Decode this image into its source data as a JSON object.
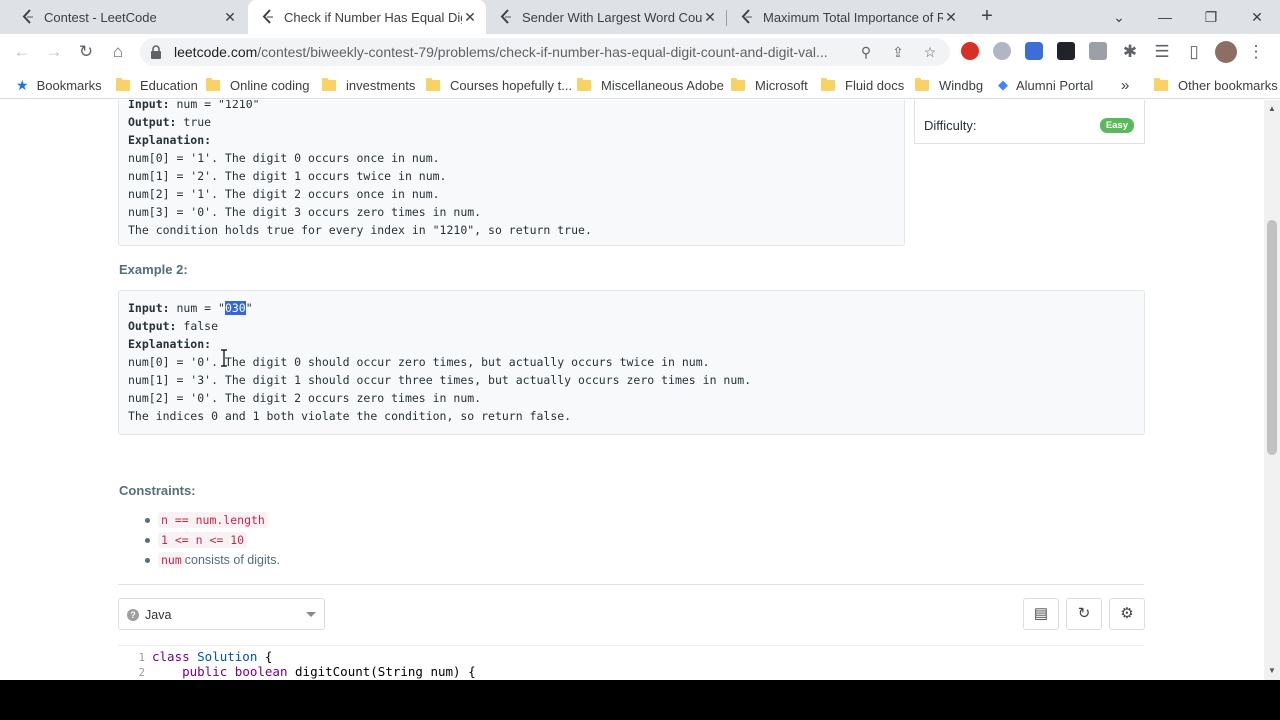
{
  "tabs": [
    {
      "title": "Contest - LeetCode",
      "active": false
    },
    {
      "title": "Check if Number Has Equal Digit",
      "active": true
    },
    {
      "title": "Sender With Largest Word Count",
      "active": false
    },
    {
      "title": "Maximum Total Importance of Ro",
      "active": false
    }
  ],
  "toolbar": {
    "url_host": "leetcode.com",
    "url_path": "/contest/biweekly-contest-79/problems/check-if-number-has-equal-digit-count-and-digit-val..."
  },
  "bookmarks": {
    "items": [
      "Bookmarks",
      "Education",
      "Online coding",
      "investments",
      "Courses hopefully t...",
      "Miscellaneous Adobe",
      "Microsoft",
      "Fluid docs",
      "Windbg",
      "Alumni Portal"
    ],
    "overflow": "»",
    "other": "Other bookmarks"
  },
  "example1": {
    "lines": [
      {
        "label": "Input:",
        "text": " num = \"1210\""
      },
      {
        "label": "Output:",
        "text": " true"
      },
      {
        "label": "Explanation:",
        "text": ""
      },
      {
        "label": "",
        "text": "num[0] = '1'. The digit 0 occurs once in num."
      },
      {
        "label": "",
        "text": "num[1] = '2'. The digit 1 occurs twice in num."
      },
      {
        "label": "",
        "text": "num[2] = '1'. The digit 2 occurs once in num."
      },
      {
        "label": "",
        "text": "num[3] = '0'. The digit 3 occurs zero times in num."
      },
      {
        "label": "",
        "text": "The condition holds true for every index in \"1210\", so return true."
      }
    ]
  },
  "example2": {
    "heading": "Example 2:",
    "input_label": "Input:",
    "input_prefix": " num = \"",
    "input_selected": "030",
    "input_suffix": "\"",
    "output_label": "Output:",
    "output_value": " false",
    "explanation_label": "Explanation:",
    "lines": [
      "num[0] = '0'. The digit 0 should occur zero times, but actually occurs twice in num.",
      "num[1] = '3'. The digit 1 should occur three times, but actually occurs zero times in num.",
      "num[2] = '0'. The digit 2 occurs zero times in num.",
      "The indices 0 and 1 both violate the condition, so return false."
    ]
  },
  "constraints": {
    "heading": "Constraints:",
    "items": [
      {
        "code": "n == num.length",
        "text": ""
      },
      {
        "code": "1 <= n <= 10",
        "text": ""
      },
      {
        "code": "num",
        "text": " consists of digits."
      }
    ]
  },
  "difficulty": {
    "label": "Difficulty:",
    "value": "Easy",
    "color": "#5cb85c"
  },
  "editor": {
    "language": "Java",
    "lines": [
      {
        "num": "1",
        "kw": "class ",
        "ty": "Solution",
        "rest": " {"
      },
      {
        "num": "2",
        "kw": "    public ",
        "ty": "boolean ",
        "rest": "digitCount(String num) {"
      }
    ]
  }
}
